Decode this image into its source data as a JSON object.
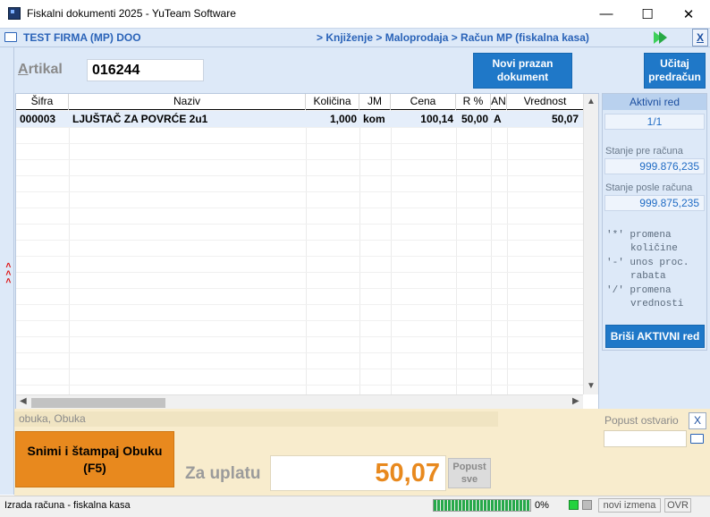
{
  "window": {
    "title": "Fiskalni dokumenti 2025 - YuTeam Software",
    "minimize": "—",
    "maximize": "☐",
    "close": "✕"
  },
  "header": {
    "company": "TEST FIRMA (MP) DOO",
    "breadcrumb": "> Knjiženje > Maloprodaja > Račun MP (fiskalna kasa)",
    "close_label": "X"
  },
  "left_strip": {
    "arrows": "< < <"
  },
  "artikal": {
    "label_first": "A",
    "label_rest": "rtikal",
    "value": "016244"
  },
  "buttons": {
    "new_doc_line1": "Novi prazan",
    "new_doc_line2": "dokument",
    "load_pred_line1": "Učitaj",
    "load_pred_line2": "predračun",
    "delete_active": "Briši AKTIVNI red",
    "save_print_line1": "Snimi i štampaj Obuku",
    "save_print_line2": "(F5)",
    "popust_all_line1": "Popust",
    "popust_all_line2": "sve"
  },
  "grid": {
    "columns": [
      "Šifra",
      "Naziv",
      "Količina",
      "JM",
      "Cena",
      "R %",
      "AN",
      "Vrednost"
    ],
    "rows": [
      {
        "sifra": "000003",
        "naziv": "LJUŠTAČ ZA POVRĆE 2u1",
        "kolicina": "1,000",
        "jm": "kom",
        "cena": "100,14",
        "rabat": "50,00",
        "an": "A",
        "vrednost": "50,07"
      }
    ]
  },
  "right_panel": {
    "title": "Aktivni red",
    "page": "1/1",
    "stanje_pre_label": "Stanje pre računa",
    "stanje_pre_value": "999.876,235",
    "stanje_posle_label": "Stanje posle računa",
    "stanje_posle_value": "999.875,235",
    "hints": [
      {
        "key": "'*' promena",
        "rest": "količine"
      },
      {
        "key": "'-' unos proc.",
        "rest": "rabata"
      },
      {
        "key": "'/' promena",
        "rest": "vrednosti"
      }
    ]
  },
  "bottom": {
    "user": "obuka, Obuka",
    "popust_label": "Popust ostvario",
    "popust_close": "X",
    "za_uplatu_label": "Za uplatu",
    "total": "50,07"
  },
  "statusbar": {
    "text": "Izrada računa - fiskalna kasa",
    "progress_pct": "0%",
    "nove_izmena": "novi izmena",
    "ovr": "OVR"
  },
  "colors": {
    "accent_blue": "#1f78c8",
    "orange": "#e8891e",
    "panel_bg": "#dde9f8",
    "bottom_bg": "#f8eccd",
    "progress_green": "#26a94a"
  },
  "icons": [
    "app-icon",
    "folder-icon",
    "play-icon",
    "minimize-icon",
    "maximize-icon",
    "close-icon",
    "chevron-up-icon",
    "chevron-down-icon",
    "chevron-left-icon",
    "chevron-right-icon"
  ]
}
